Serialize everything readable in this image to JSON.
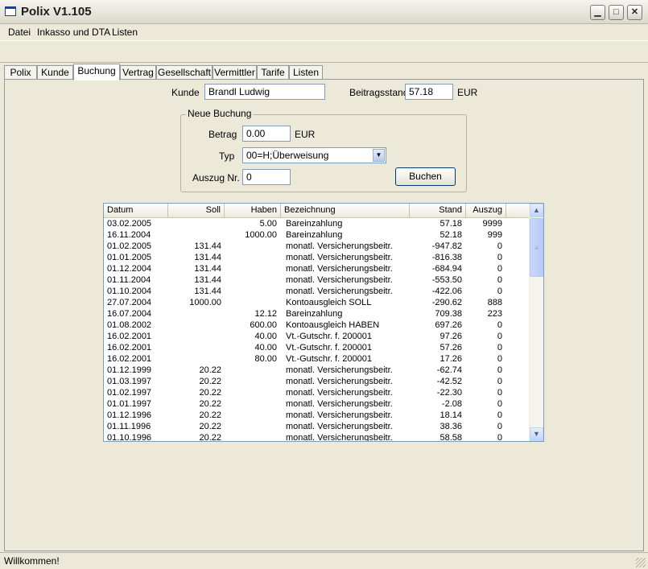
{
  "window": {
    "title": "Polix V1.105"
  },
  "menu": [
    "Datei",
    "Inkasso und DTA",
    "Listen"
  ],
  "tabs": [
    "Polix",
    "Kunde",
    "Buchung",
    "Vertrag",
    "Gesellschaft",
    "Vermittler",
    "Tarife",
    "Listen"
  ],
  "active_tab": "Buchung",
  "header": {
    "kunde_label": "Kunde",
    "kunde_value": "Brandl Ludwig",
    "beitragsstand_label": "Beitragsstand",
    "beitragsstand_value": "57.18",
    "currency": "EUR"
  },
  "neue_buchung": {
    "legend": "Neue Buchung",
    "betrag_label": "Betrag",
    "betrag_value": "0.00",
    "betrag_currency": "EUR",
    "typ_label": "Typ",
    "typ_value": "00=H;Überweisung",
    "auszug_label": "Auszug Nr.",
    "auszug_value": "0",
    "buchen_label": "Buchen"
  },
  "table": {
    "columns": [
      "Datum",
      "Soll",
      "Haben",
      "Bezeichnung",
      "Stand",
      "Auszug"
    ],
    "rows": [
      [
        "03.02.2005",
        "",
        "5.00",
        "Bareinzahlung",
        "57.18",
        "9999"
      ],
      [
        "16.11.2004",
        "",
        "1000.00",
        "Bareinzahlung",
        "52.18",
        "999"
      ],
      [
        "01.02.2005",
        "131.44",
        "",
        "monatl. Versicherungsbeitr.",
        "-947.82",
        "0"
      ],
      [
        "01.01.2005",
        "131.44",
        "",
        "monatl. Versicherungsbeitr.",
        "-816.38",
        "0"
      ],
      [
        "01.12.2004",
        "131.44",
        "",
        "monatl. Versicherungsbeitr.",
        "-684.94",
        "0"
      ],
      [
        "01.11.2004",
        "131.44",
        "",
        "monatl. Versicherungsbeitr.",
        "-553.50",
        "0"
      ],
      [
        "01.10.2004",
        "131.44",
        "",
        "monatl. Versicherungsbeitr.",
        "-422.06",
        "0"
      ],
      [
        "27.07.2004",
        "1000.00",
        "",
        "Kontoausgleich SOLL",
        "-290.62",
        "888"
      ],
      [
        "16.07.2004",
        "",
        "12.12",
        "Bareinzahlung",
        "709.38",
        "223"
      ],
      [
        "01.08.2002",
        "",
        "600.00",
        "Kontoausgleich HABEN",
        "697.26",
        "0"
      ],
      [
        "16.02.2001",
        "",
        "40.00",
        "Vt.-Gutschr. f. 200001",
        "97.26",
        "0"
      ],
      [
        "16.02.2001",
        "",
        "40.00",
        "Vt.-Gutschr. f. 200001",
        "57.26",
        "0"
      ],
      [
        "16.02.2001",
        "",
        "80.00",
        "Vt.-Gutschr. f. 200001",
        "17.26",
        "0"
      ],
      [
        "01.12.1999",
        "20.22",
        "",
        "monatl. Versicherungsbeitr.",
        "-62.74",
        "0"
      ],
      [
        "01.03.1997",
        "20.22",
        "",
        "monatl. Versicherungsbeitr.",
        "-42.52",
        "0"
      ],
      [
        "01.02.1997",
        "20.22",
        "",
        "monatl. Versicherungsbeitr.",
        "-22.30",
        "0"
      ],
      [
        "01.01.1997",
        "20.22",
        "",
        "monatl. Versicherungsbeitr.",
        "-2.08",
        "0"
      ],
      [
        "01.12.1996",
        "20.22",
        "",
        "monatl. Versicherungsbeitr.",
        "18.14",
        "0"
      ],
      [
        "01.11.1996",
        "20.22",
        "",
        "monatl. Versicherungsbeitr.",
        "38.36",
        "0"
      ],
      [
        "01.10.1996",
        "20.22",
        "",
        "monatl. Versicherungsbeitr.",
        "58.58",
        "0"
      ]
    ]
  },
  "status": {
    "text": "Willkommen!"
  }
}
